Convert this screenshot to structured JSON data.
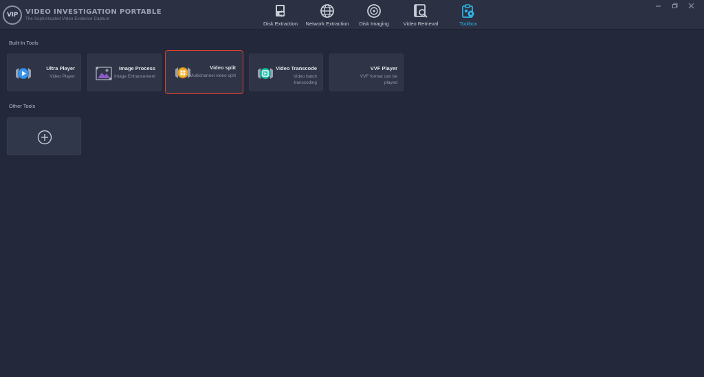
{
  "app": {
    "logo_abbr": "VIP",
    "title": "VIDEO INVESTIGATION PORTABLE",
    "subtitle": "The Sophisticated Video Evidence Capture"
  },
  "nav": [
    {
      "label": "Disk Extraction",
      "icon": "disk-extraction-icon"
    },
    {
      "label": "Network Extraction",
      "icon": "globe-icon"
    },
    {
      "label": "Disk Imaging",
      "icon": "disc-icon"
    },
    {
      "label": "Video Retrieval",
      "icon": "video-search-icon"
    },
    {
      "label": "Toolbox",
      "icon": "toolbox-icon",
      "active": true
    }
  ],
  "window_controls": [
    "minimize",
    "restore",
    "close"
  ],
  "sections": {
    "builtin": "Built-In Tools",
    "other": "Other Tools"
  },
  "tools": [
    {
      "title": "Ultra Player",
      "desc": "Video Player",
      "icon": "play-icon"
    },
    {
      "title": "Image Process",
      "desc": "Image Enhancement",
      "icon": "image-icon"
    },
    {
      "title": "Video split",
      "desc": "Multichannel video split",
      "icon": "split-icon",
      "highlight": true
    },
    {
      "title": "Video Transcode",
      "desc": "Video batch transcoding",
      "icon": "transcode-icon"
    },
    {
      "title": "VVF Player",
      "desc": "VVF format can be played",
      "icon": ""
    }
  ],
  "colors": {
    "background": "#23283a",
    "topbar": "#2b3142",
    "card": "#2f3546",
    "accent": "#2fb3e8",
    "highlight": "#e0402f"
  }
}
